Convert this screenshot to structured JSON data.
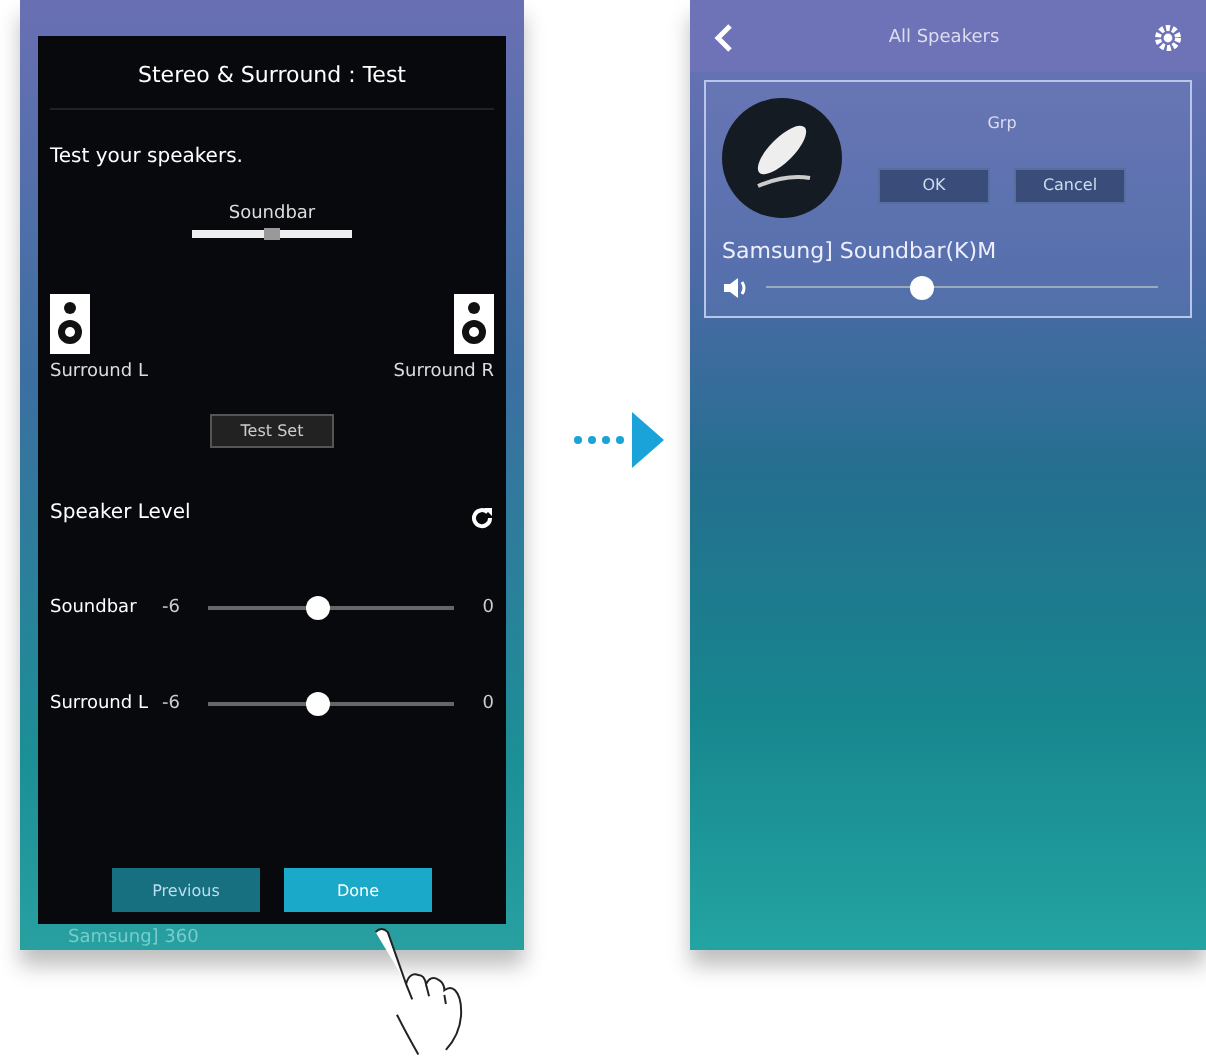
{
  "left_screen": {
    "title": "Stereo & Surround : Test",
    "prompt": "Test your speakers.",
    "center_speaker": "Soundbar",
    "speakers": [
      {
        "label": "Surround L"
      },
      {
        "label": "Surround R"
      }
    ],
    "test_button": "Test Set",
    "section": "Speaker Level",
    "levels": [
      {
        "name": "Soundbar",
        "min": "-6",
        "max": "0",
        "level": 0.45
      },
      {
        "name": "Surround L",
        "min": "-6",
        "max": "0",
        "level": 0.45
      }
    ],
    "buttons": [
      {
        "label": "Previous",
        "selected": false
      },
      {
        "label": "Done",
        "selected": true
      }
    ],
    "footer": "Samsung] 360"
  },
  "right_screen": {
    "title": "All Speakers",
    "group": "Grp",
    "buttons": [
      "OK",
      "Cancel"
    ],
    "device": "Samsung] Soundbar(K)M",
    "volume": {
      "level": 0.4
    }
  }
}
